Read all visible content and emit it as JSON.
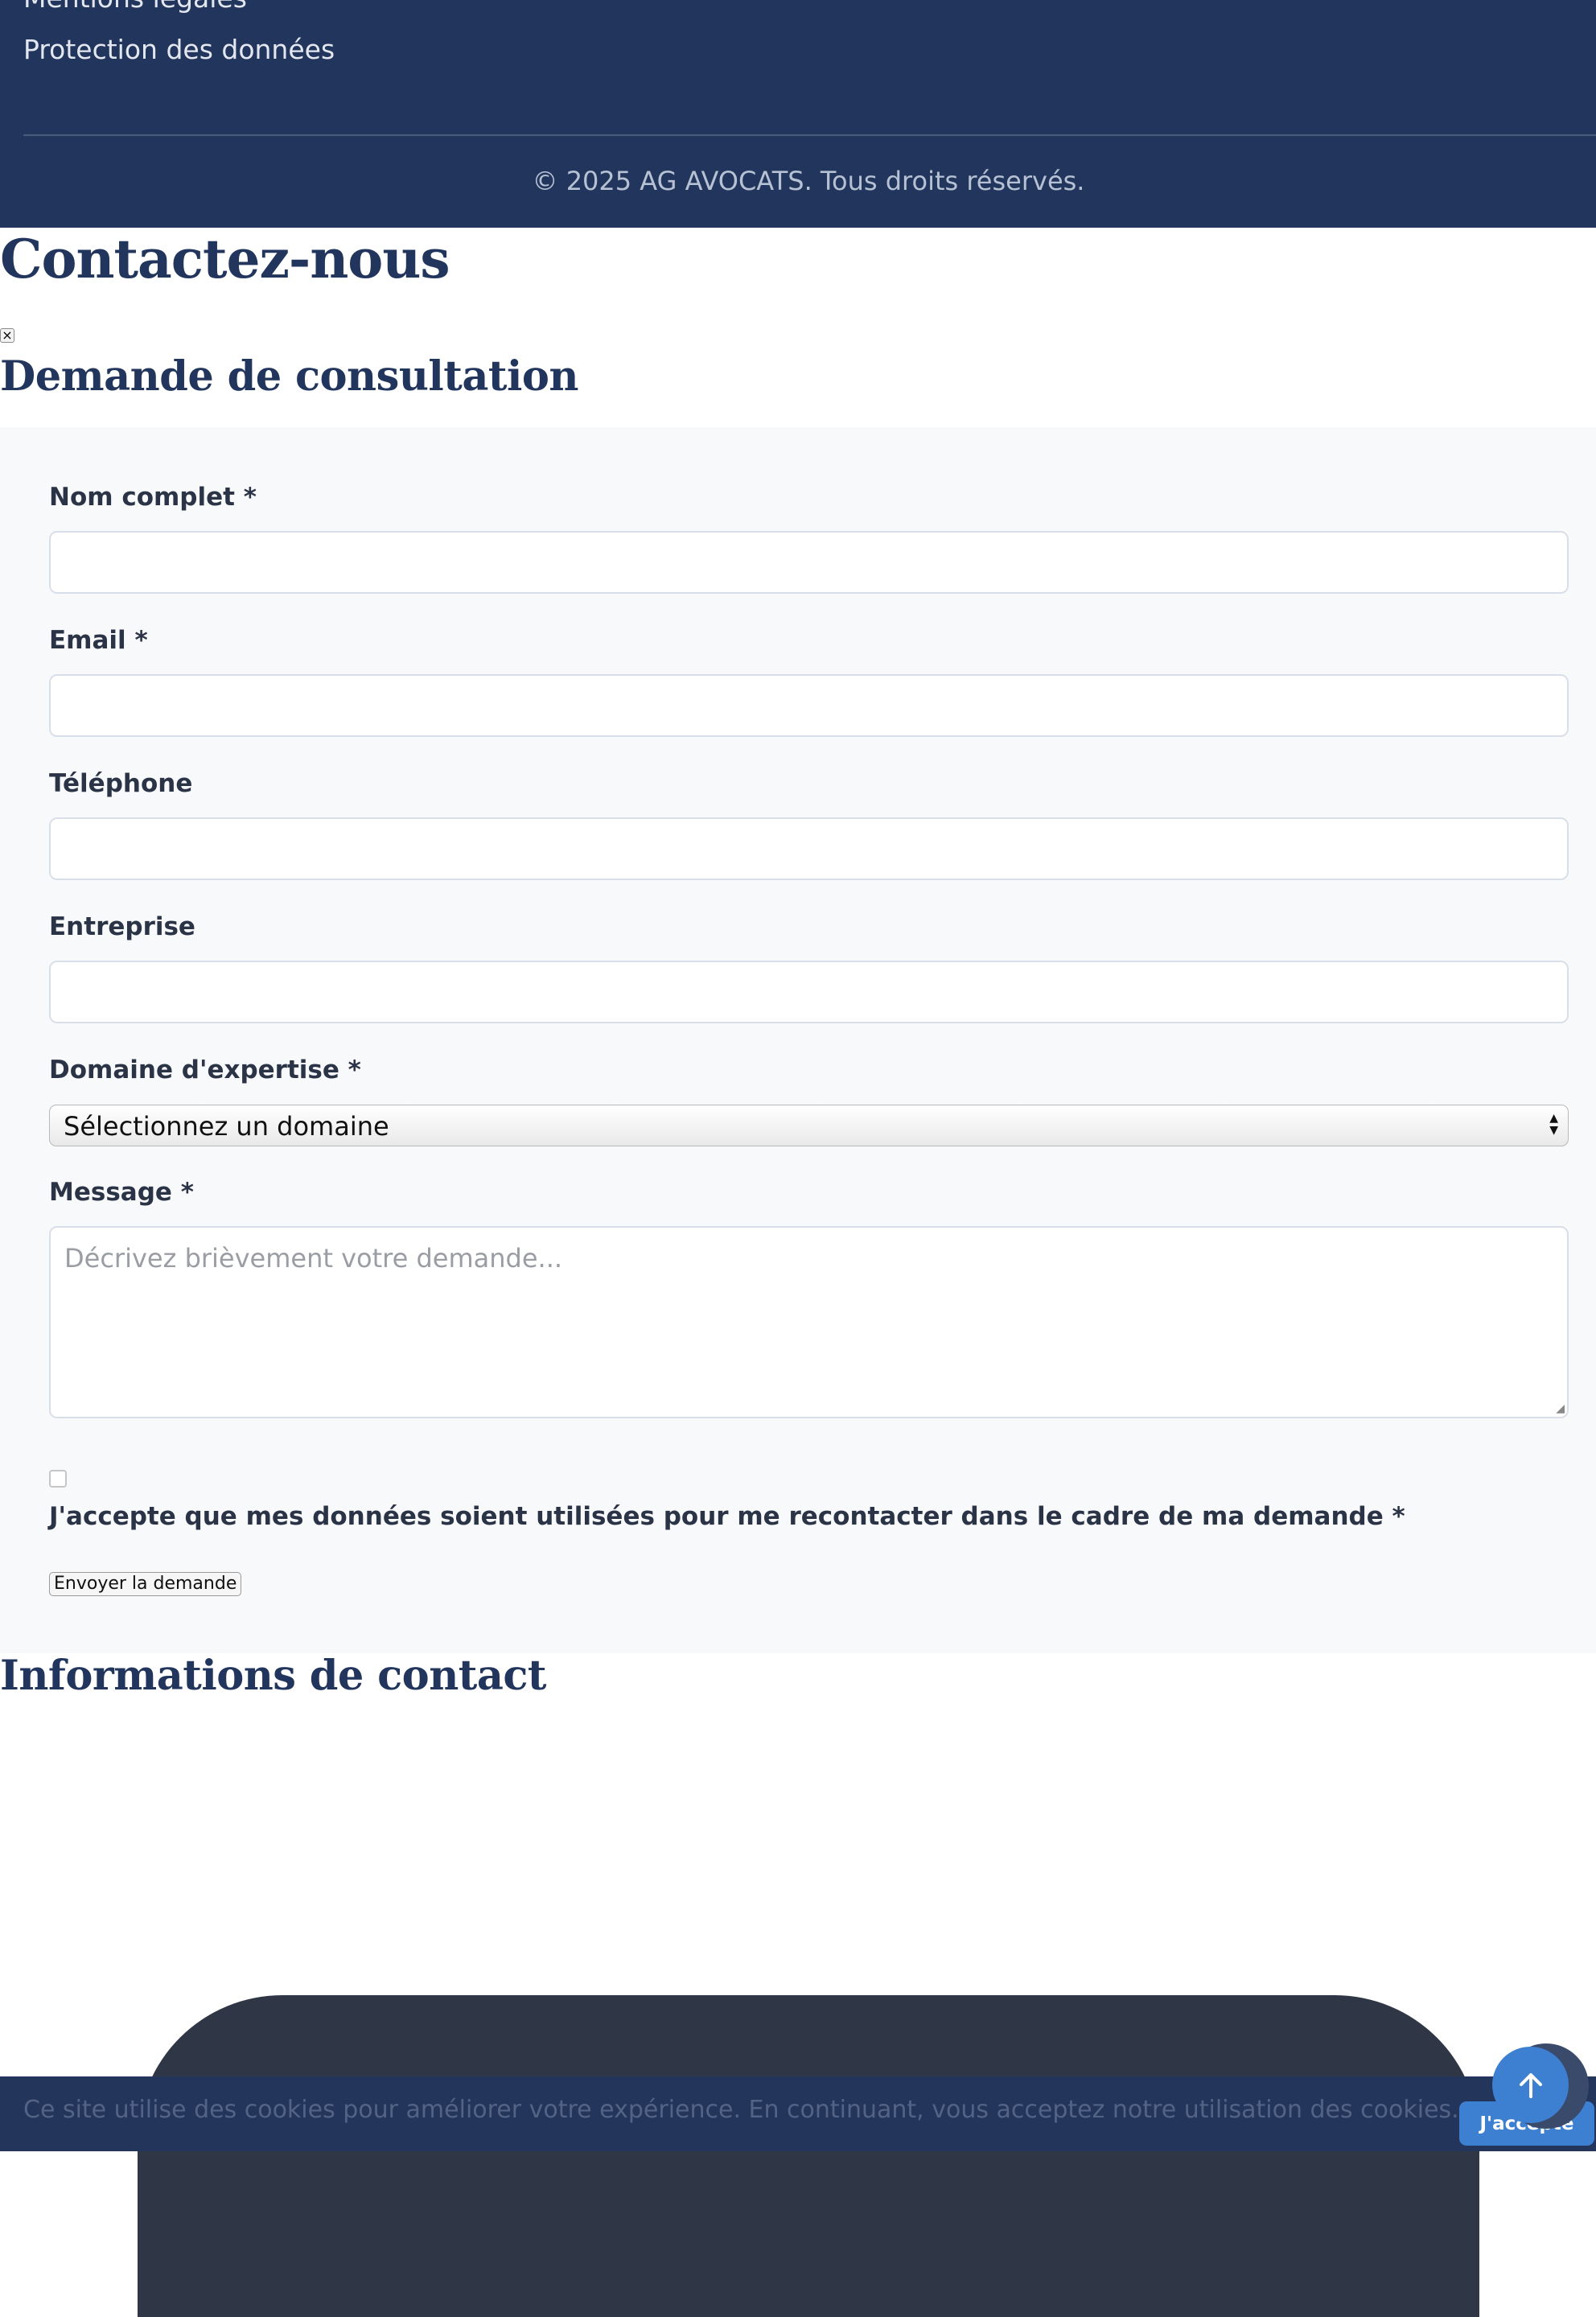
{
  "footer": {
    "links": [
      "Mentions légales",
      "Protection des données"
    ],
    "copyright": "© 2025 AG AVOCATS. Tous droits réservés."
  },
  "page": {
    "title": "Contactez-nous",
    "close_glyph": "×"
  },
  "form": {
    "title": "Demande de consultation",
    "fields": {
      "name_label": "Nom complet *",
      "email_label": "Email *",
      "phone_label": "Téléphone",
      "company_label": "Entreprise",
      "domain_label": "Domaine d'expertise *",
      "domain_selected": "Sélectionnez un domaine",
      "message_label": "Message *",
      "message_placeholder": "Décrivez brièvement votre demande..."
    },
    "consent_label": "J'accepte que mes données soient utilisées pour me recontacter dans le cadre de ma demande *",
    "submit_label": "Envoyer la demande"
  },
  "contact": {
    "title": "Informations de contact"
  },
  "cookie": {
    "text": "Ce site utilise des cookies pour améliorer votre expérience. En continuant, vous acceptez notre utilisation des cookies.",
    "accept_label": "J'accepte"
  },
  "icons": {
    "scroll_top": "arrow-up-icon"
  },
  "colors": {
    "navy": "#22355c",
    "accent": "#3d7fd0",
    "panel": "#f8f9fb"
  }
}
